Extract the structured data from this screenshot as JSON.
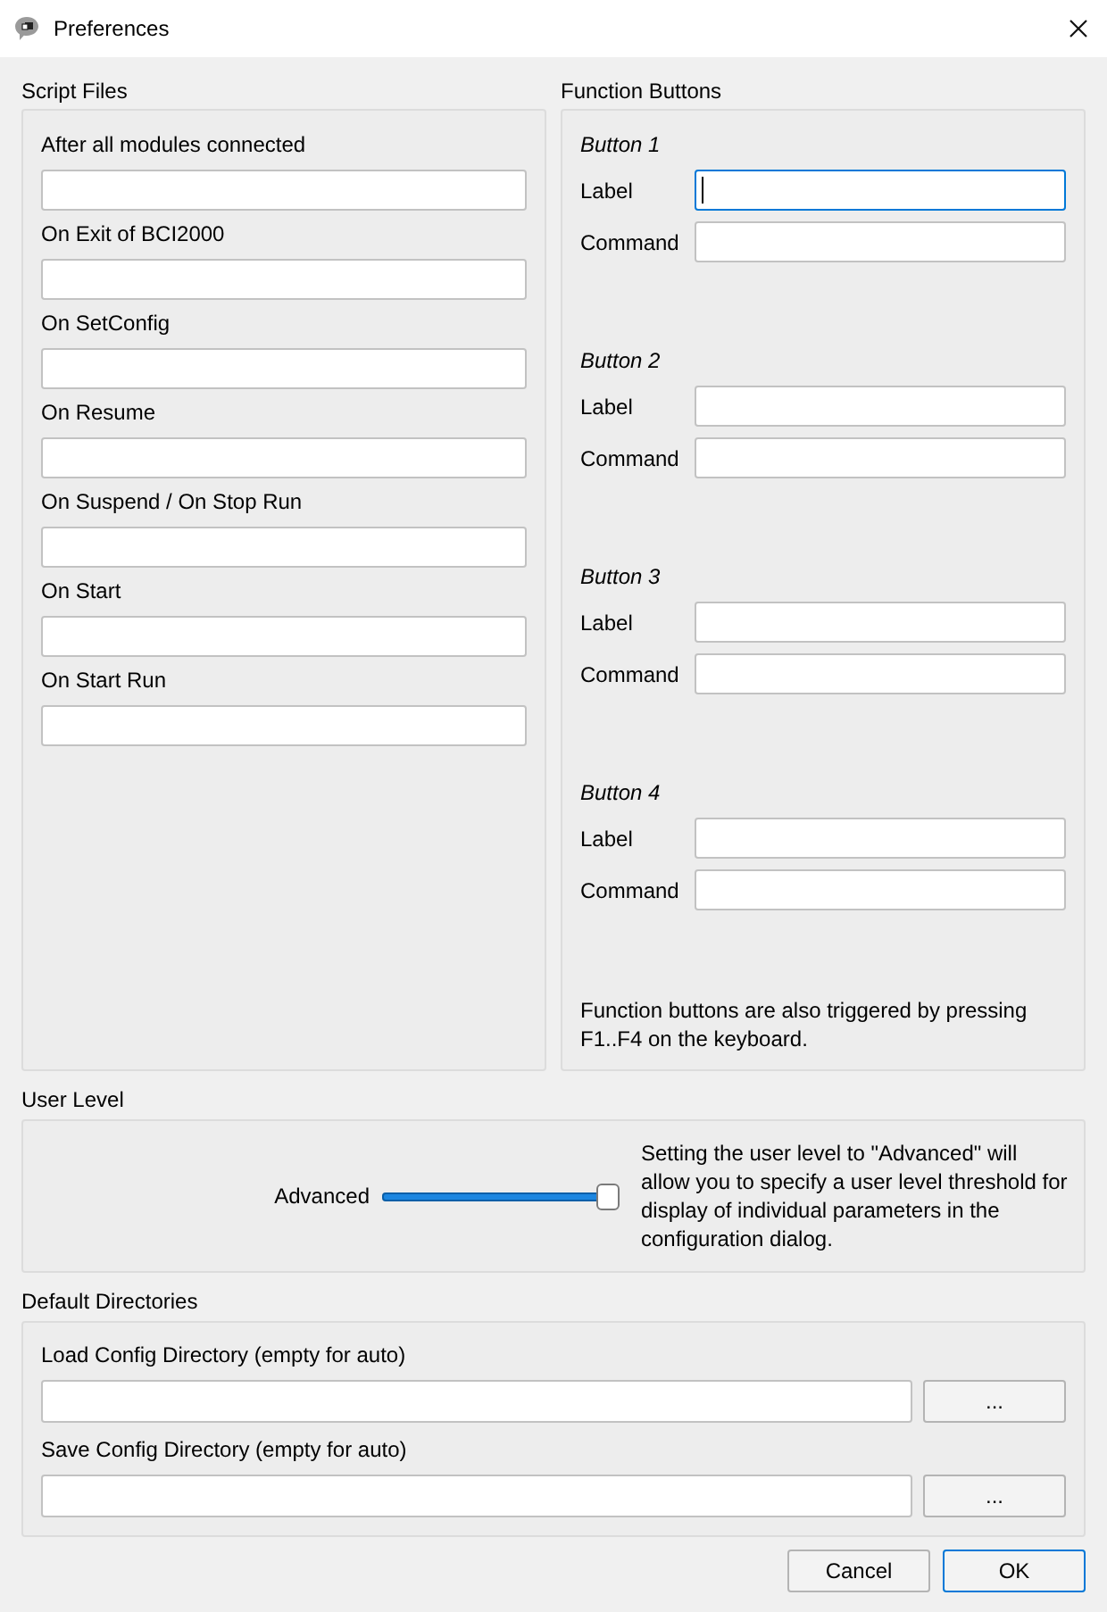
{
  "window": {
    "title": "Preferences"
  },
  "script_files": {
    "title": "Script Files",
    "items": [
      {
        "label": "After all modules connected"
      },
      {
        "label": "On Exit of BCI2000"
      },
      {
        "label": "On SetConfig"
      },
      {
        "label": "On Resume"
      },
      {
        "label": "On Suspend / On Stop Run"
      },
      {
        "label": "On Start"
      },
      {
        "label": "On Start Run"
      }
    ]
  },
  "function_buttons": {
    "title": "Function Buttons",
    "groups": [
      {
        "title": "Button 1",
        "fields": [
          {
            "label": "Label",
            "focused": true
          },
          {
            "label": "Command",
            "focused": false
          }
        ]
      },
      {
        "title": "Button 2",
        "fields": [
          {
            "label": "Label",
            "focused": false
          },
          {
            "label": "Command",
            "focused": false
          }
        ]
      },
      {
        "title": "Button 3",
        "fields": [
          {
            "label": "Label",
            "focused": false
          },
          {
            "label": "Command",
            "focused": false
          }
        ]
      },
      {
        "title": "Button 4",
        "fields": [
          {
            "label": "Label",
            "focused": false
          },
          {
            "label": "Command",
            "focused": false
          }
        ]
      }
    ],
    "note": "Function buttons are also triggered by pressing F1..F4 on the keyboard."
  },
  "user_level": {
    "title": "User Level",
    "label": "Advanced",
    "level": 1,
    "description": "Setting the user level to \"Advanced\" will allow you to specify a user level threshold for display of individual parameters in the configuration dialog."
  },
  "default_directories": {
    "title": "Default Directories",
    "items": [
      {
        "label": "Load Config Directory (empty for auto)",
        "button": "..."
      },
      {
        "label": "Save Config Directory (empty for auto)",
        "button": "..."
      }
    ]
  },
  "buttons": [
    {
      "label": "Cancel",
      "default": false
    },
    {
      "label": "OK",
      "default": true
    }
  ]
}
